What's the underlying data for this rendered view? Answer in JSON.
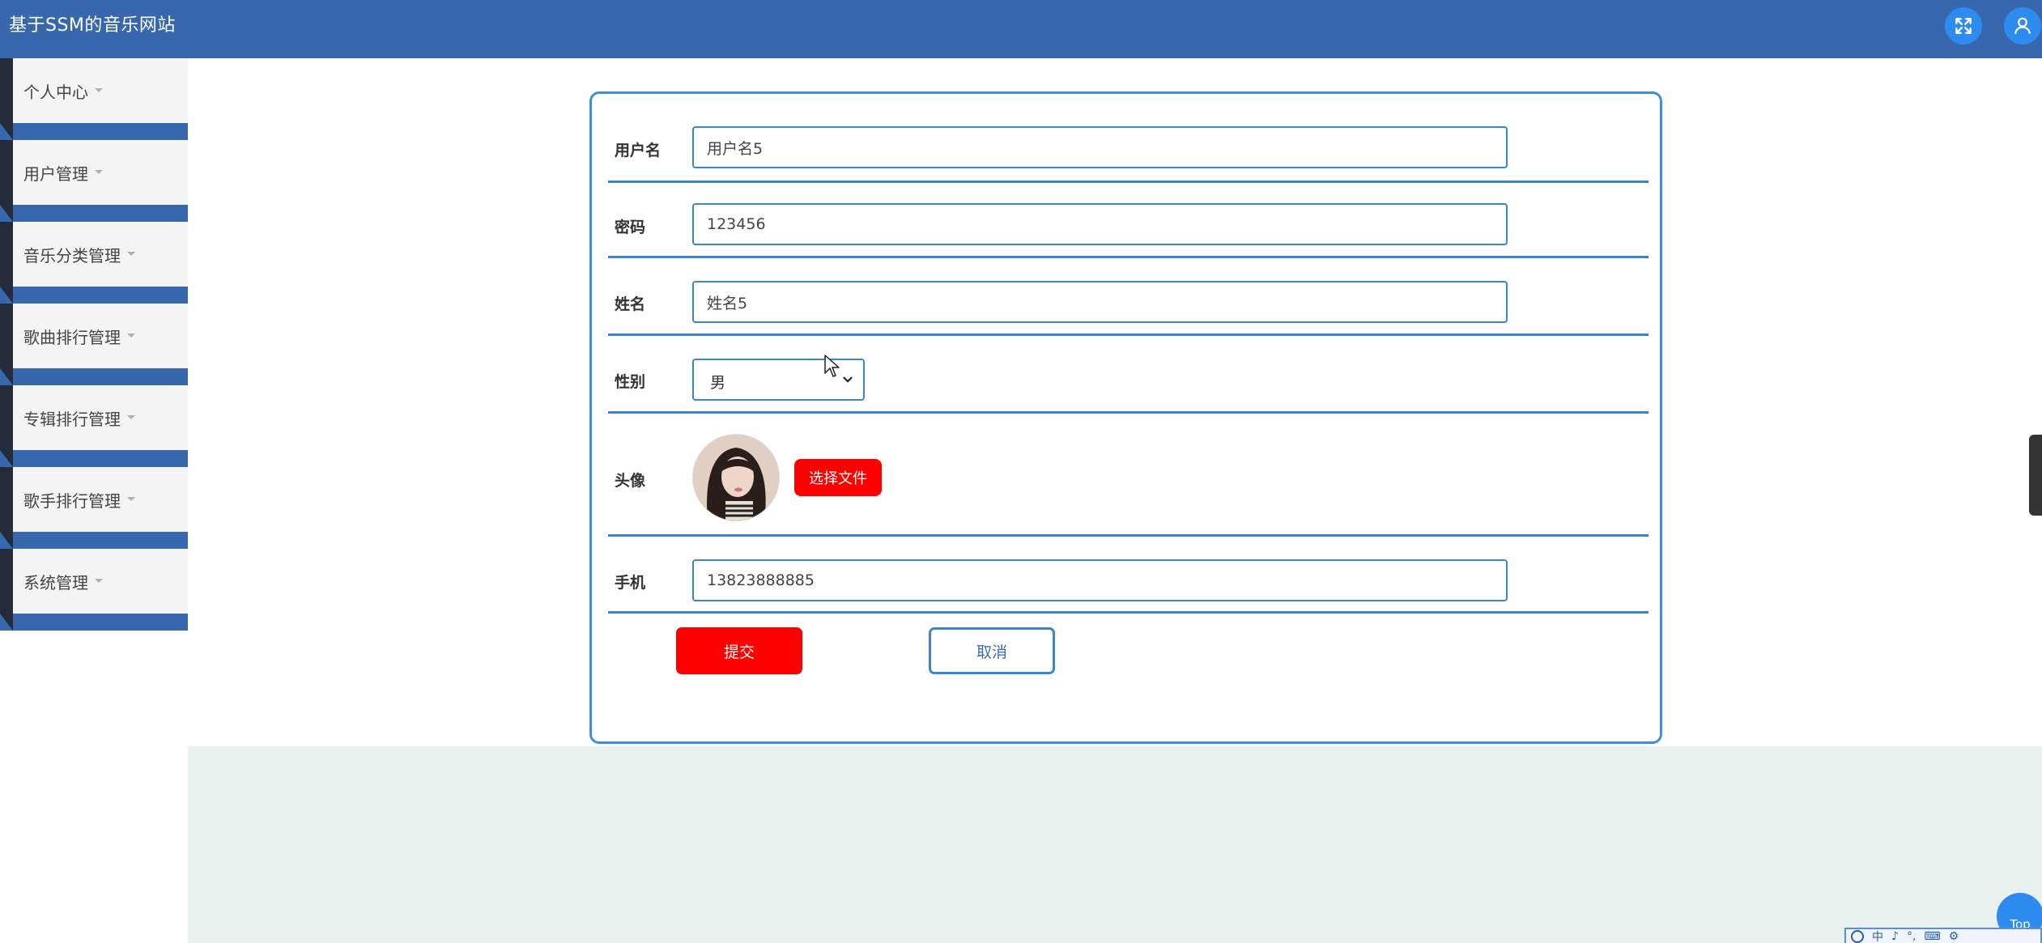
{
  "header": {
    "title": "基于SSM的音乐网站",
    "fullscreen_icon": "fullscreen-toggle-icon",
    "user_icon": "user-icon",
    "accent": "#3768ad"
  },
  "sidebar": {
    "items": [
      {
        "label": "个人中心"
      },
      {
        "label": "用户管理"
      },
      {
        "label": "音乐分类管理"
      },
      {
        "label": "歌曲排行管理"
      },
      {
        "label": "专辑排行管理"
      },
      {
        "label": "歌手排行管理"
      },
      {
        "label": "系统管理"
      }
    ]
  },
  "form": {
    "username": {
      "label": "用户名",
      "value": "用户名5"
    },
    "password": {
      "label": "密码",
      "value": "123456"
    },
    "name": {
      "label": "姓名",
      "value": "姓名5"
    },
    "gender": {
      "label": "性别",
      "value": "男"
    },
    "avatar": {
      "label": "头像",
      "button": "选择文件"
    },
    "phone": {
      "label": "手机",
      "value": "13823888885"
    },
    "submit_label": "提交",
    "cancel_label": "取消"
  },
  "top_button": {
    "label": "Top"
  },
  "ime": {
    "items": [
      "中",
      "♪",
      "°,",
      "⌨",
      "⚙"
    ]
  }
}
